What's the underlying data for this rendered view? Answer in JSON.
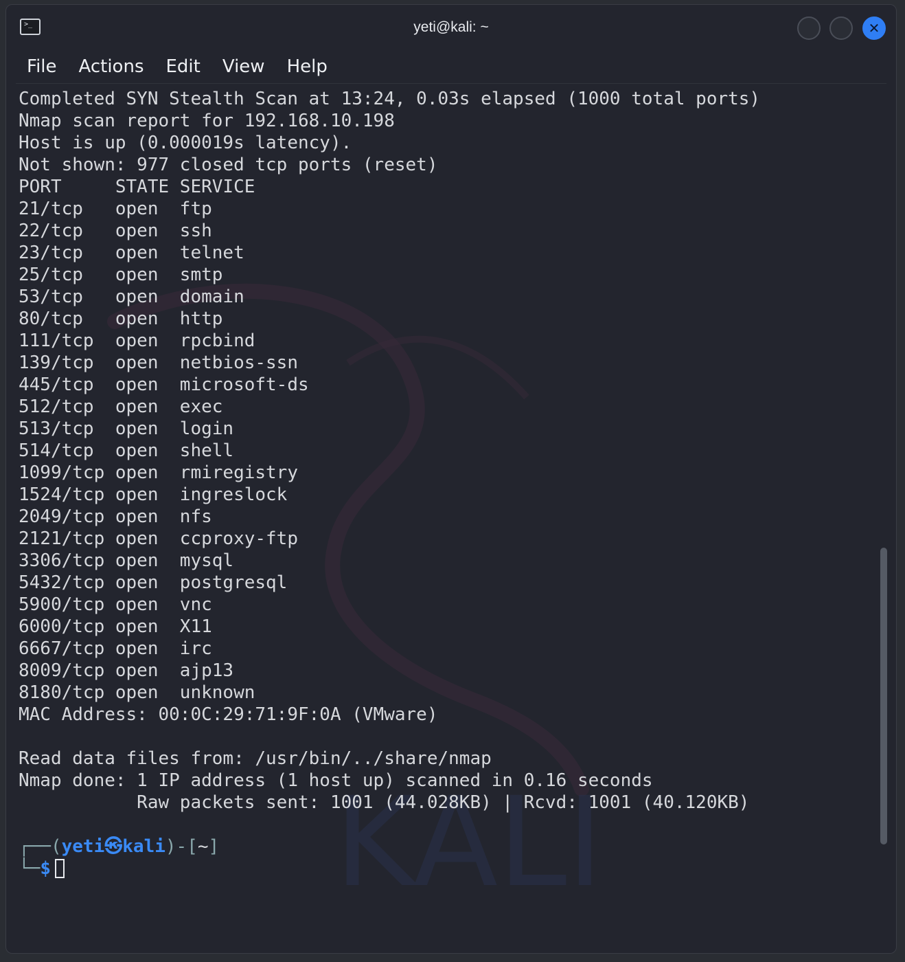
{
  "window": {
    "title": "yeti@kali: ~",
    "app_icon": "terminal-icon",
    "buttons": [
      {
        "name": "minimize",
        "icon": "minimize-icon"
      },
      {
        "name": "maximize",
        "icon": "maximize-icon"
      },
      {
        "name": "close",
        "icon": "close-icon",
        "glyph": "✕",
        "color": "#2f7ef4"
      }
    ]
  },
  "menu": [
    "File",
    "Actions",
    "Edit",
    "View",
    "Help"
  ],
  "terminal": {
    "output_lines": [
      "Completed SYN Stealth Scan at 13:24, 0.03s elapsed (1000 total ports)",
      "Nmap scan report for 192.168.10.198",
      "Host is up (0.000019s latency).",
      "Not shown: 977 closed tcp ports (reset)",
      "PORT     STATE SERVICE",
      "21/tcp   open  ftp",
      "22/tcp   open  ssh",
      "23/tcp   open  telnet",
      "25/tcp   open  smtp",
      "53/tcp   open  domain",
      "80/tcp   open  http",
      "111/tcp  open  rpcbind",
      "139/tcp  open  netbios-ssn",
      "445/tcp  open  microsoft-ds",
      "512/tcp  open  exec",
      "513/tcp  open  login",
      "514/tcp  open  shell",
      "1099/tcp open  rmiregistry",
      "1524/tcp open  ingreslock",
      "2049/tcp open  nfs",
      "2121/tcp open  ccproxy-ftp",
      "3306/tcp open  mysql",
      "5432/tcp open  postgresql",
      "5900/tcp open  vnc",
      "6000/tcp open  X11",
      "6667/tcp open  irc",
      "8009/tcp open  ajp13",
      "8180/tcp open  unknown",
      "MAC Address: 00:0C:29:71:9F:0A (VMware)",
      "",
      "Read data files from: /usr/bin/../share/nmap",
      "Nmap done: 1 IP address (1 host up) scanned in 0.16 seconds",
      "           Raw packets sent: 1001 (44.028KB) | Rcvd: 1001 (40.120KB)",
      ""
    ],
    "prompt": {
      "frame_top": "┌──(",
      "user": "yeti",
      "at_symbol": "㉿",
      "host": "kali",
      "frame_mid": ")-[",
      "cwd": "~",
      "frame_end": "]",
      "frame_bottom": "└─",
      "symbol": "$"
    },
    "watermark_text": "KALI",
    "colors": {
      "background": "#23252e",
      "text": "#d6d8dc",
      "prompt_accent": "#3a8af5"
    }
  }
}
